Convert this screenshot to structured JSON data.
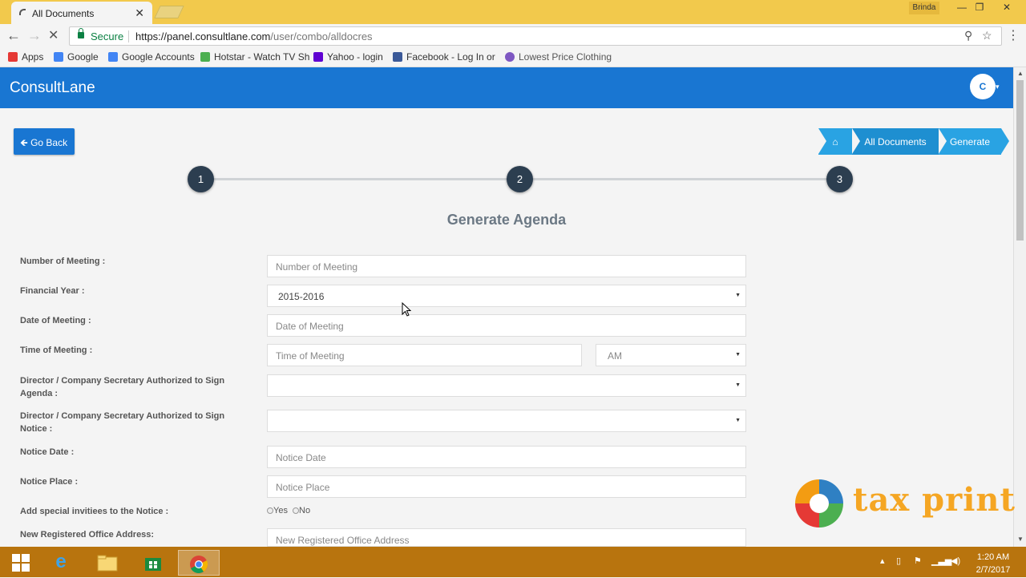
{
  "browser": {
    "tab_title": "All Documents",
    "tab_close": "✕",
    "profile_name": "Brinda",
    "secure_label": "Secure",
    "url_host": "https://panel.consultlane.com",
    "url_path": "/user/combo/alldocres",
    "bookmarks": [
      {
        "label": "Apps",
        "color": "#e53935"
      },
      {
        "label": "Google",
        "color": "#4285f4"
      },
      {
        "label": "Google Accounts",
        "color": "#4285f4"
      },
      {
        "label": "Hotstar - Watch TV Sh",
        "color": "#4caf50"
      },
      {
        "label": "Yahoo - login",
        "color": "#5f01d1"
      },
      {
        "label": "Facebook - Log In or",
        "color": "#3b5998"
      },
      {
        "label": "Lowest Price Clothing",
        "color": "#7e57c2"
      }
    ]
  },
  "app": {
    "brand": "ConsultLane",
    "avatar_initial": "C",
    "go_back": "Go Back",
    "breadcrumb": {
      "home_icon": "⌂",
      "all_documents": "All Documents",
      "generate": "Generate"
    },
    "steps": [
      "1",
      "2",
      "3"
    ],
    "form_title": "Generate Agenda"
  },
  "form": {
    "number_of_meeting": {
      "label": "Number of Meeting :",
      "placeholder": "Number of Meeting"
    },
    "financial_year": {
      "label": "Financial Year :",
      "value": "2015-2016"
    },
    "date_of_meeting": {
      "label": "Date of Meeting :",
      "placeholder": "Date of Meeting"
    },
    "time_of_meeting": {
      "label": "Time of Meeting :",
      "placeholder": "Time of Meeting",
      "ampm": "AM"
    },
    "director_agenda": {
      "label": "Director / Company Secretary Authorized to Sign Agenda :",
      "value": ""
    },
    "director_notice": {
      "label": "Director / Company Secretary Authorized to Sign Notice :",
      "value": ""
    },
    "notice_date": {
      "label": "Notice Date :",
      "placeholder": "Notice Date"
    },
    "notice_place": {
      "label": "Notice Place :",
      "placeholder": "Notice Place"
    },
    "special_invitees": {
      "label": "Add special invitiees to the Notice :",
      "yes": "Yes",
      "no": "No"
    },
    "new_office_address": {
      "label": "New Registered Office Address:",
      "placeholder": "New Registered Office Address"
    }
  },
  "watermark": {
    "text": "tax print"
  },
  "taskbar": {
    "time": "1:20 AM",
    "date": "2/7/2017"
  }
}
